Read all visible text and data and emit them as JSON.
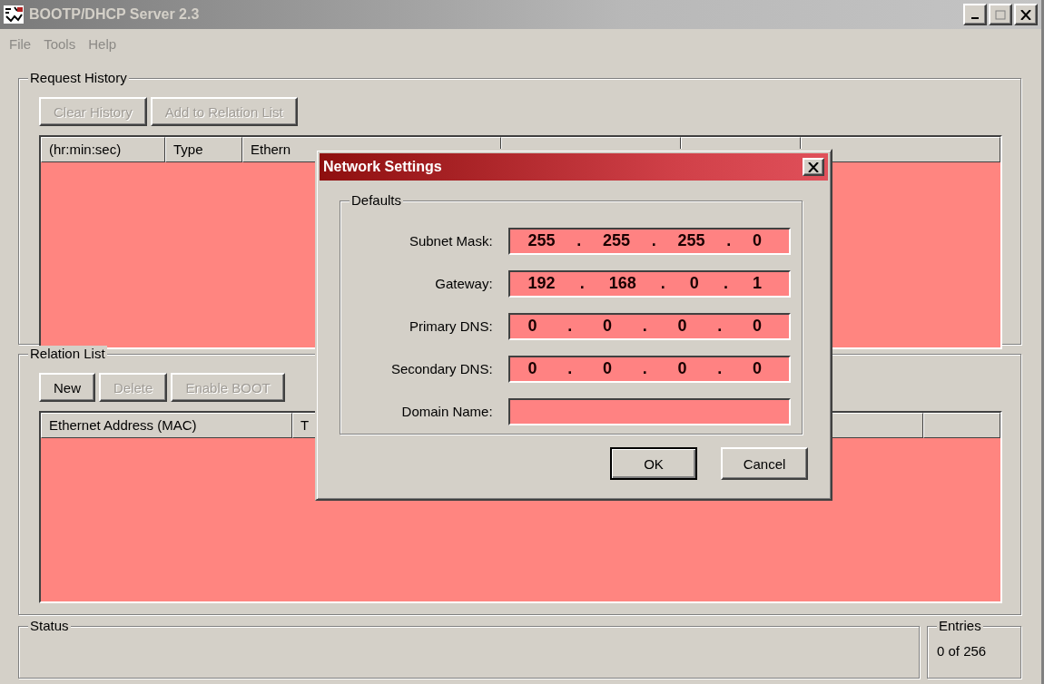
{
  "window": {
    "title": "BOOTP/DHCP Server 2.3"
  },
  "menu": [
    {
      "label": "File",
      "disabled": true
    },
    {
      "label": "Tools",
      "disabled": true
    },
    {
      "label": "Help",
      "disabled": true
    }
  ],
  "request_history": {
    "title": "Request History",
    "buttons": [
      {
        "label": "Clear History",
        "disabled": true
      },
      {
        "label": "Add to Relation List",
        "disabled": true
      }
    ],
    "columns": [
      "(hr:min:sec)",
      "Type",
      "Ethern"
    ]
  },
  "relation_list": {
    "title": "Relation List",
    "buttons": [
      {
        "label": "New",
        "disabled": false
      },
      {
        "label": "Delete",
        "disabled": true
      },
      {
        "label": "Enable BOOT",
        "disabled": true
      }
    ],
    "columns": [
      "Ethernet Address (MAC)",
      "T"
    ]
  },
  "status": {
    "title": "Status"
  },
  "entries": {
    "title": "Entries",
    "value": "0 of 256"
  },
  "dialog": {
    "title": "Network Settings",
    "group": "Defaults",
    "fields": [
      {
        "label": "Subnet Mask:",
        "kind": "ip",
        "parts": [
          "255",
          ".",
          "255",
          ".",
          "255",
          ".",
          "0"
        ]
      },
      {
        "label": "Gateway:",
        "kind": "ip",
        "parts": [
          "192",
          ".",
          "168",
          ".",
          "0",
          ".",
          "1"
        ]
      },
      {
        "label": "Primary DNS:",
        "kind": "ip",
        "parts": [
          "0",
          ".",
          "0",
          ".",
          "0",
          ".",
          "0"
        ]
      },
      {
        "label": "Secondary DNS:",
        "kind": "ip",
        "parts": [
          "0",
          ".",
          "0",
          ".",
          "0",
          ".",
          "0"
        ]
      },
      {
        "label": "Domain Name:",
        "kind": "text"
      }
    ],
    "buttons": [
      {
        "label": "OK",
        "default": true
      },
      {
        "label": "Cancel",
        "default": false
      }
    ]
  }
}
